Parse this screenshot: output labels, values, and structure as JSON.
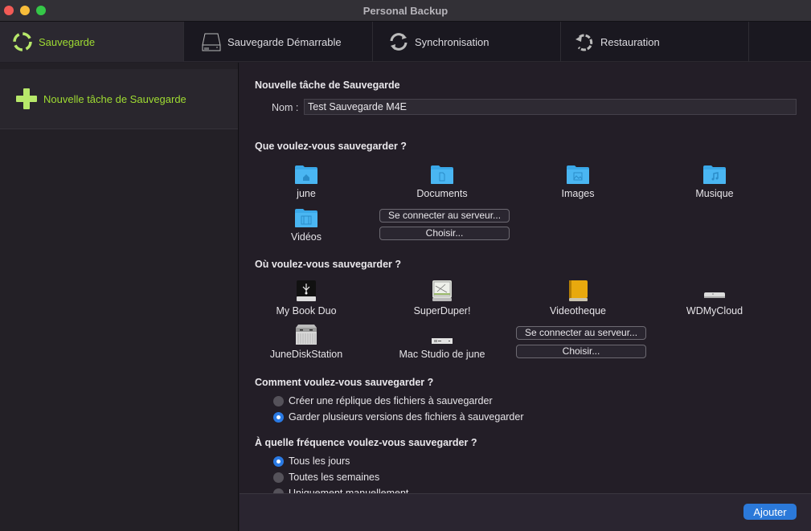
{
  "window": {
    "title": "Personal Backup"
  },
  "tabs": [
    {
      "label": "Sauvegarde",
      "icon": "backup-ring-icon",
      "active": true
    },
    {
      "label": "Sauvegarde Démarrable",
      "icon": "drive-icon",
      "active": false
    },
    {
      "label": "Synchronisation",
      "icon": "sync-icon",
      "active": false
    },
    {
      "label": "Restauration",
      "icon": "restore-icon",
      "active": false
    }
  ],
  "sidebar": {
    "items": [
      {
        "label": "Nouvelle tâche de Sauvegarde",
        "icon": "plus-icon"
      }
    ]
  },
  "form": {
    "title": "Nouvelle tâche de Sauvegarde",
    "name_label": "Nom :",
    "name_value": "Test Sauvegarde M4E",
    "what": {
      "heading": "Que voulez-vous sauvegarder ?",
      "items": [
        {
          "label": "june",
          "icon": "home-folder-icon"
        },
        {
          "label": "Documents",
          "icon": "documents-folder-icon"
        },
        {
          "label": "Images",
          "icon": "pictures-folder-icon"
        },
        {
          "label": "Musique",
          "icon": "music-folder-icon"
        },
        {
          "label": "Vidéos",
          "icon": "movies-folder-icon"
        }
      ],
      "connect_label": "Se connecter au serveur...",
      "choose_label": "Choisir..."
    },
    "where": {
      "heading": "Où voulez-vous sauvegarder ?",
      "items": [
        {
          "label": "My Book Duo",
          "icon": "usb-drive-icon"
        },
        {
          "label": "SuperDuper!",
          "icon": "superduper-drive-icon"
        },
        {
          "label": "Videotheque",
          "icon": "yellow-drive-icon"
        },
        {
          "label": "WDMyCloud",
          "icon": "network-server-icon"
        },
        {
          "label": "JuneDiskStation",
          "icon": "nas-server-icon"
        },
        {
          "label": "Mac Studio de june",
          "icon": "mac-studio-icon"
        }
      ],
      "connect_label": "Se connecter au serveur...",
      "choose_label": "Choisir..."
    },
    "how": {
      "heading": "Comment voulez-vous sauvegarder ?",
      "options": [
        {
          "label": "Créer une réplique des fichiers à sauvegarder",
          "selected": false
        },
        {
          "label": "Garder plusieurs versions des fichiers à sauvegarder",
          "selected": true
        }
      ]
    },
    "frequency": {
      "heading": "À quelle fréquence voulez-vous sauvegarder ?",
      "options": [
        {
          "label": "Tous les jours",
          "selected": true
        },
        {
          "label": "Toutes les semaines",
          "selected": false
        },
        {
          "label": "Uniquement manuellement",
          "selected": false
        }
      ]
    }
  },
  "footer": {
    "add_label": "Ajouter"
  },
  "colors": {
    "accent_green": "#9fdc32",
    "accent_blue": "#2b79d9",
    "folder_blue": "#3aa8e8"
  }
}
